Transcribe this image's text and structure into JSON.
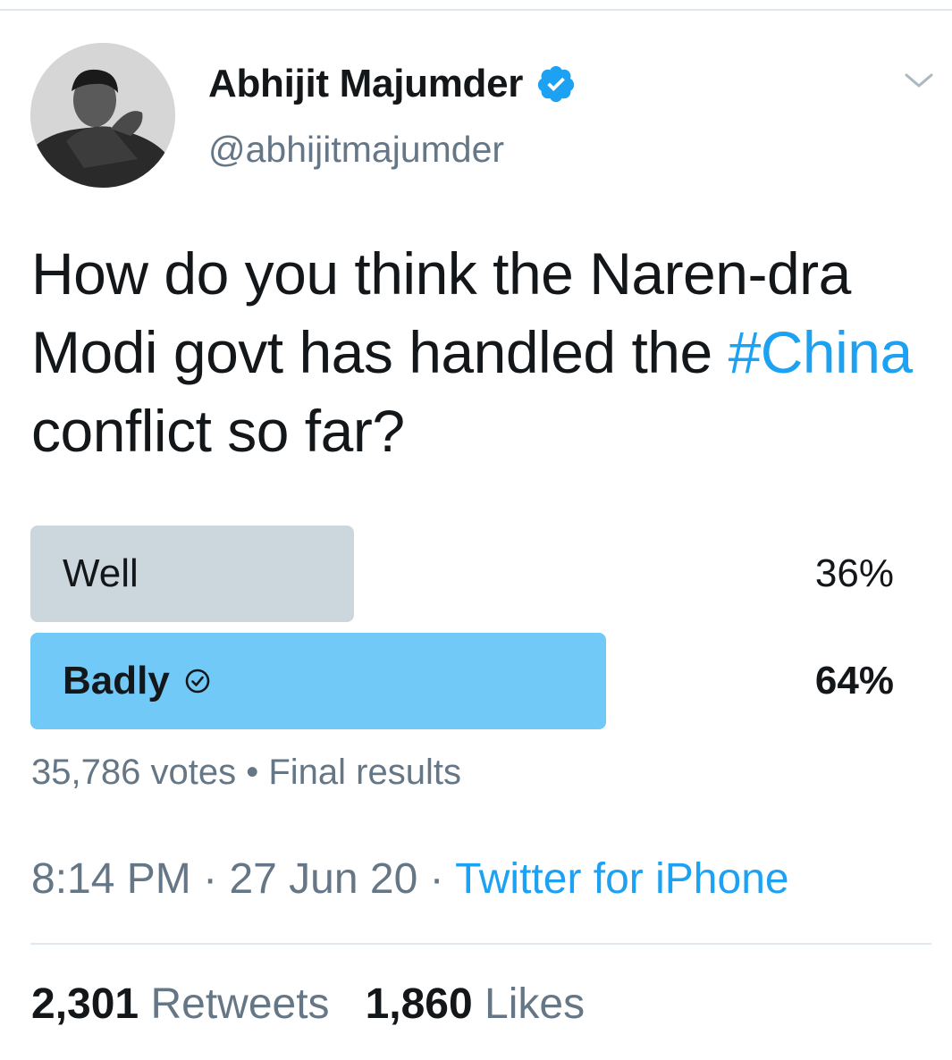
{
  "author": {
    "display_name": "Abhijit Majumder",
    "handle": "@abhijitmajumder",
    "verified": true,
    "avatar_icon": "user-avatar-photo"
  },
  "tweet": {
    "text_before": "How do you think the Naren-dra Modi govt has handled the ",
    "hashtag": "#China",
    "text_after": " conflict so far?"
  },
  "poll": {
    "options": [
      {
        "label": "Well",
        "percent_label": "36%",
        "percent": 36,
        "winner": false
      },
      {
        "label": "Badly",
        "percent_label": "64%",
        "percent": 64,
        "winner": true
      }
    ],
    "votes": "35,786 votes",
    "separator": "•",
    "status": "Final results"
  },
  "meta": {
    "time": "8:14 PM",
    "date": "27 Jun 20",
    "source": "Twitter for iPhone",
    "dot": "·"
  },
  "stats": {
    "retweets_count": "2,301",
    "retweets_label": "Retweets",
    "likes_count": "1,860",
    "likes_label": "Likes"
  },
  "colors": {
    "accent": "#1da1f2",
    "winner_bar": "#71c9f8",
    "loser_bar": "#ccd6dd",
    "muted_text": "#657786"
  }
}
